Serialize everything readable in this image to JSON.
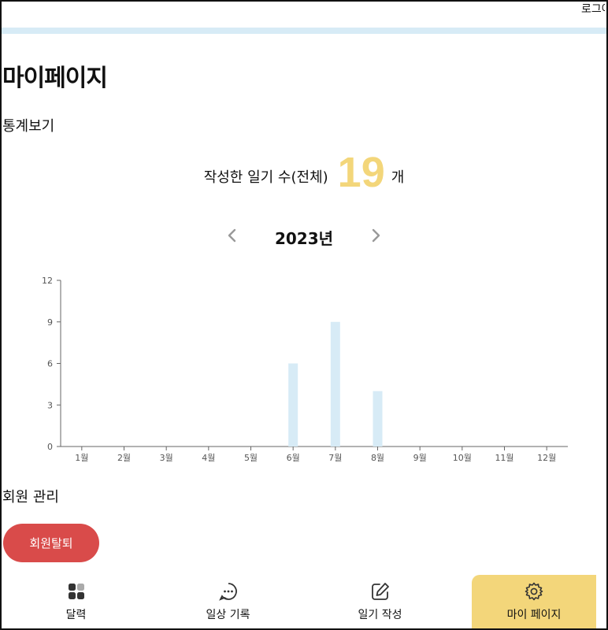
{
  "header": {
    "logout_label": "로그아웃"
  },
  "page_title": "마이페이지",
  "stats": {
    "section_title": "통계보기",
    "total_label": "작성한 일기 수(전체)",
    "total_count": "19",
    "unit": "개"
  },
  "year_nav": {
    "prev_icon": "chevron-left-icon",
    "year_label": "2023년",
    "next_icon": "chevron-right-icon"
  },
  "chart_data": {
    "type": "bar",
    "categories": [
      "1월",
      "2월",
      "3월",
      "4월",
      "5월",
      "6월",
      "7월",
      "8월",
      "9월",
      "10월",
      "11월",
      "12월"
    ],
    "values": [
      0,
      0,
      0,
      0,
      0,
      6,
      9,
      4,
      0,
      0,
      0,
      0
    ],
    "ylim": [
      0,
      12
    ],
    "yticks": [
      0,
      3,
      6,
      9,
      12
    ],
    "bar_color": "#d7ebf6",
    "grid": false
  },
  "account": {
    "section_title": "회원 관리",
    "withdraw_label": "회원탈퇴"
  },
  "bottom_nav": {
    "items": [
      {
        "label": "달력",
        "icon": "grid-icon"
      },
      {
        "label": "일상 기록",
        "icon": "chat-bubble-icon"
      },
      {
        "label": "일기 작성",
        "icon": "edit-icon"
      },
      {
        "label": "마이 페이지",
        "icon": "gear-icon"
      }
    ],
    "active_color": "#f3d67a"
  }
}
